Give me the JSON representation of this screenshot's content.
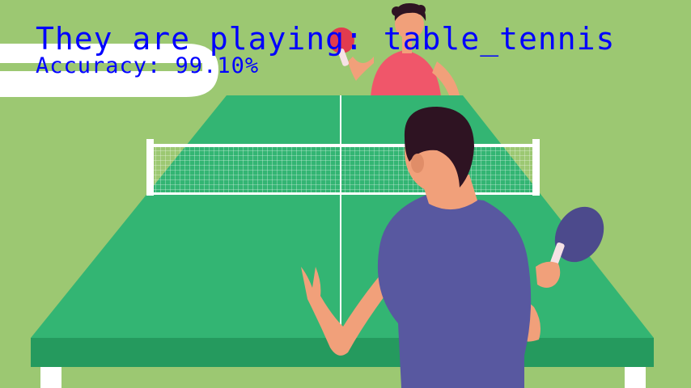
{
  "overlay": {
    "headline": "They are playing: table_tennis",
    "accuracy": "Accuracy: 99.10%"
  },
  "colors": {
    "background": "#9cc872",
    "table_top": "#33b573",
    "table_edge": "#259a5e",
    "net": "#ffffff",
    "shirt_front_player": "#5858a0",
    "shirt_back_player": "#f0566a",
    "skin": "#f1a07a",
    "hair": "#2e1322",
    "paddle": "#4c4a8c",
    "overlay_text": "#0000ff"
  }
}
